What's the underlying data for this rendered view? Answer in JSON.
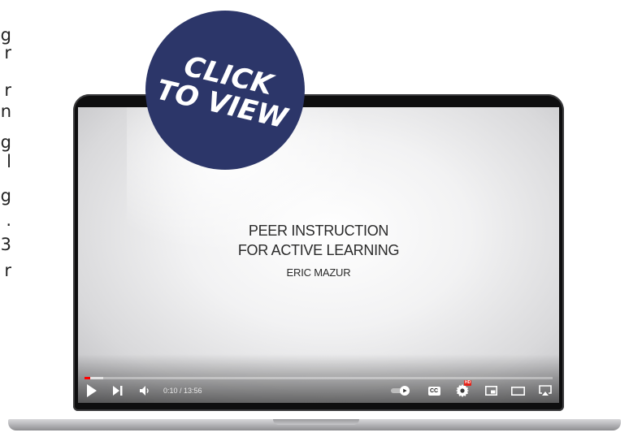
{
  "side_text": {
    "fragments": [
      "g",
      "r",
      "r",
      "n",
      "g",
      "l",
      "g",
      ".",
      "3",
      "r"
    ]
  },
  "video": {
    "title_line1": "PEER INSTRUCTION",
    "title_line2": "FOR ACTIVE LEARNING",
    "presenter": "ERIC MAZUR",
    "time": "0:10 / 13:56",
    "progress_fraction": 0.012,
    "loaded_fraction": 0.04
  },
  "controls": {
    "play_icon": "play-icon",
    "next_icon": "next-icon",
    "volume_icon": "volume-icon",
    "autoplay_icon": "autoplay-toggle-icon",
    "captions_label": "CC",
    "hd_badge": "HD",
    "accent_color": "#ff0000"
  },
  "badge": {
    "line1": "CLICK",
    "line2": "TO VIEW",
    "color": "#2c3669"
  }
}
